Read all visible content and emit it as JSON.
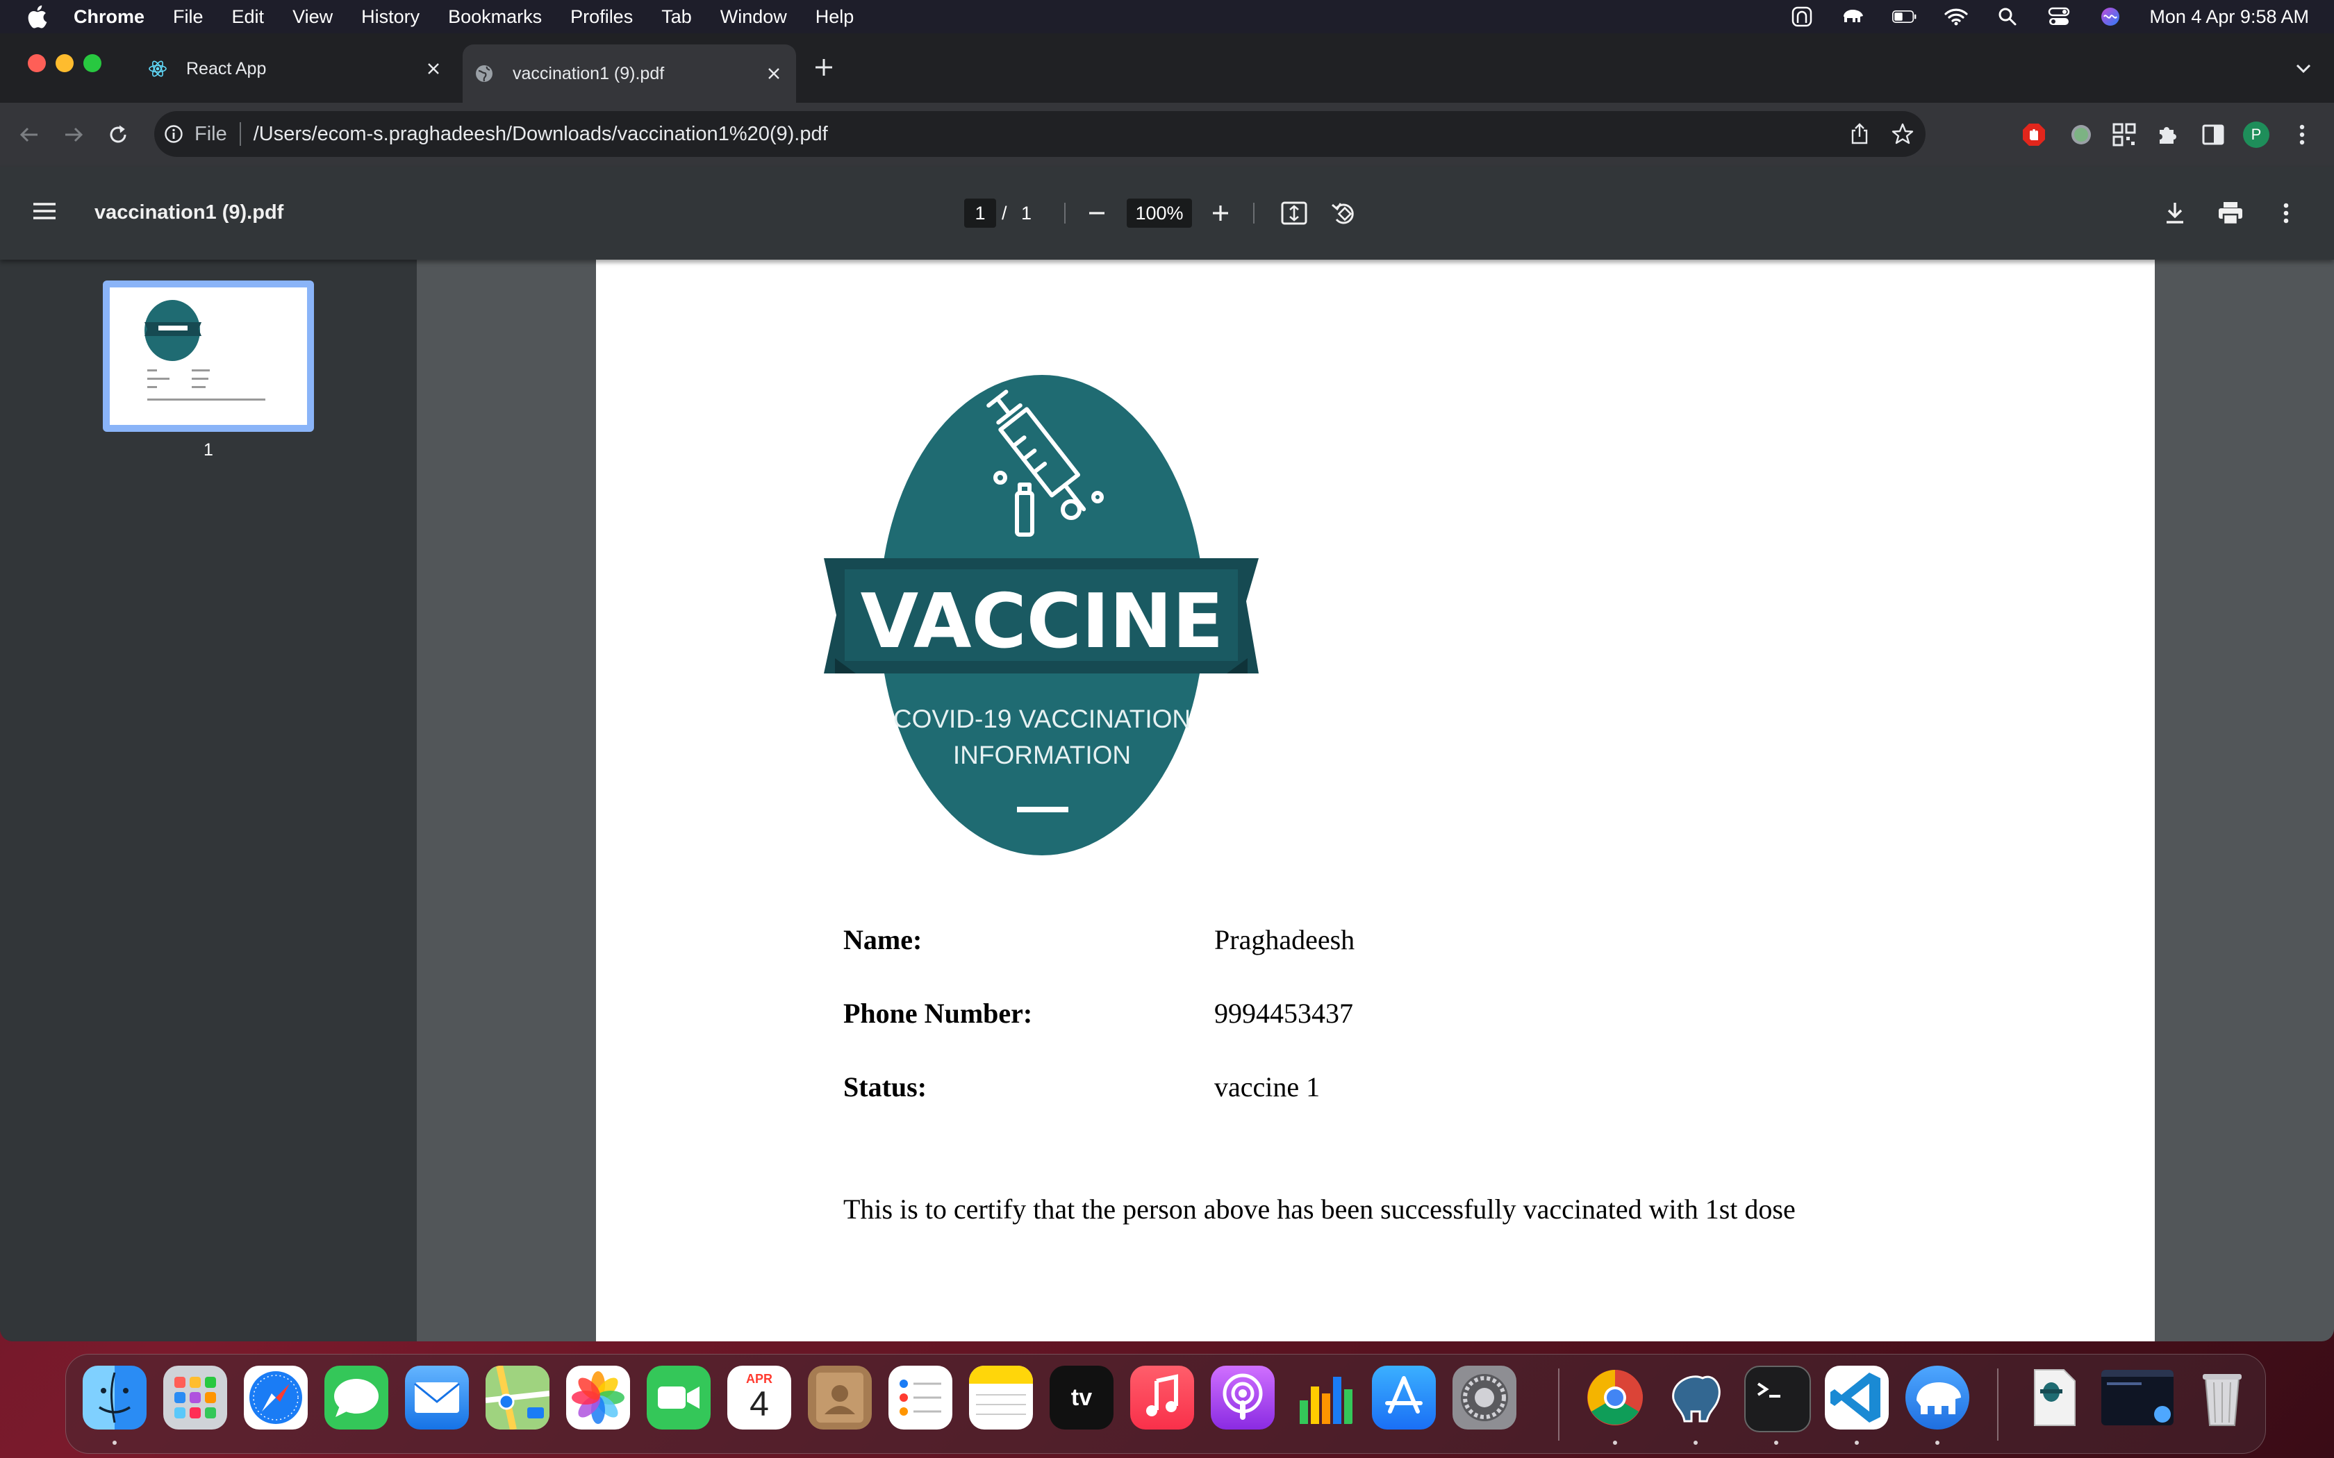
{
  "menubar": {
    "app_name": "Chrome",
    "items": [
      "File",
      "Edit",
      "View",
      "History",
      "Bookmarks",
      "Profiles",
      "Tab",
      "Window",
      "Help"
    ],
    "clock": "Mon 4 Apr  9:58 AM"
  },
  "tabs": [
    {
      "title": "React App",
      "active": false,
      "icon": "react-icon"
    },
    {
      "title": "vaccination1 (9).pdf",
      "active": true,
      "icon": "globe-icon"
    }
  ],
  "omnibox": {
    "scheme": "File",
    "url": "/Users/ecom-s.praghadeesh/Downloads/vaccination1%20(9).pdf"
  },
  "profile": {
    "initial": "P"
  },
  "pdf_toolbar": {
    "title": "vaccination1 (9).pdf",
    "current_page": "1",
    "page_separator": "/",
    "total_pages": "1",
    "zoom": "100%"
  },
  "sidebar": {
    "thumbnail_number": "1"
  },
  "document": {
    "logo": {
      "title": "VACCINE",
      "subtitle_line1": "COVID-19 VACCINATION",
      "subtitle_line2": "INFORMATION",
      "colors": {
        "oval": "#1f6b72",
        "banner": "#164a52",
        "banner_fold": "#0f3339"
      }
    },
    "fields": [
      {
        "label": "Name:",
        "value": "Praghadeesh"
      },
      {
        "label": "Phone Number:",
        "value": "9994453437"
      },
      {
        "label": "Status:",
        "value": "vaccine 1"
      }
    ],
    "certificate_text": "This is to certify that the person above has been successfully vaccinated with 1st dose"
  },
  "dock": {
    "calendar": {
      "month": "APR",
      "day": "4"
    },
    "tv_label": "tv",
    "apps": [
      "finder",
      "launchpad",
      "safari",
      "messages",
      "mail",
      "maps",
      "photos",
      "facetime",
      "calendar",
      "contacts",
      "reminders",
      "notes",
      "apple-tv",
      "music",
      "podcasts",
      "numbers",
      "app-store",
      "system-preferences",
      "chrome",
      "pgadmin",
      "terminal",
      "vscode",
      "tableplus",
      "pdf-document",
      "screenshot",
      "trash"
    ]
  },
  "colors": {
    "chrome_dark": "#202124",
    "toolbar": "#35363a",
    "pdf_bar": "#323639",
    "viewer_bg": "#525659",
    "thumb_highlight": "#8ab4f8"
  }
}
